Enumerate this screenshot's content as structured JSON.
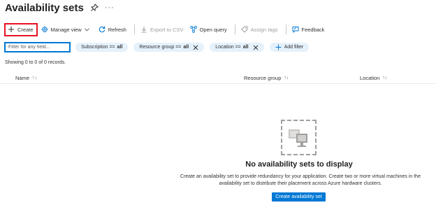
{
  "page": {
    "title": "Availability sets",
    "more": "···"
  },
  "toolbar": {
    "create": "Create",
    "manage_view": "Manage view",
    "refresh": "Refresh",
    "export_csv": "Export to CSV",
    "open_query": "Open query",
    "assign_tags": "Assign tags",
    "feedback": "Feedback"
  },
  "filters": {
    "placeholder": "Filter for any field...",
    "pills": [
      {
        "label": "Subscription ==",
        "value": "all"
      },
      {
        "label": "Resource group ==",
        "value": "all"
      },
      {
        "label": "Location ==",
        "value": "all"
      }
    ],
    "add_filter": "Add filter"
  },
  "records": "Showing 0 to 0 of 0 records.",
  "table": {
    "columns": [
      "Name",
      "Resource group",
      "Location"
    ],
    "sort_icons": [
      "↑↓",
      "↑↓",
      "↑↓"
    ]
  },
  "empty_state": {
    "title": "No availability sets to display",
    "description_line1": "Create an availability set to provide redundancy for your application. Create two or more virtual machines in the",
    "description_line2": "availability set to distribute their placement across Azure hardware clusters.",
    "button": "Create availability set"
  },
  "colors": {
    "accent": "#0078d4",
    "highlight": "#e81123",
    "pill_bg": "#e5f1fb"
  }
}
